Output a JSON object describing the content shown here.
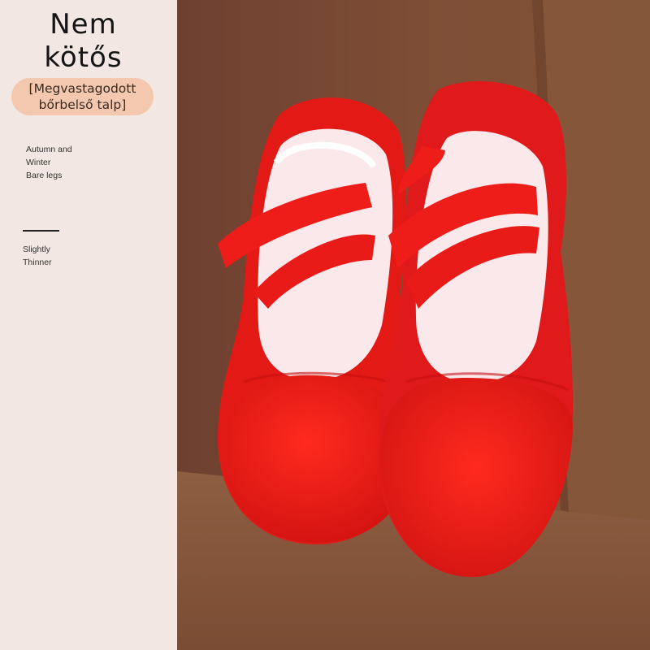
{
  "title": {
    "line1": "Nem",
    "line2": "kötős"
  },
  "badge": {
    "text": "[Megvastagodott bőrbelső talp]"
  },
  "features": {
    "season": [
      "Autumn and",
      "Winter",
      "Bare legs"
    ],
    "thickness": [
      "Slightly",
      "Thinner"
    ]
  },
  "colors": {
    "panel": "#f2e7e2",
    "badge": "#f3c8ae",
    "background": "#7a4a33",
    "shoe": "#e61a1a"
  },
  "photo": {
    "subject": "red canvas ballet shoes with crossed elastic straps"
  }
}
